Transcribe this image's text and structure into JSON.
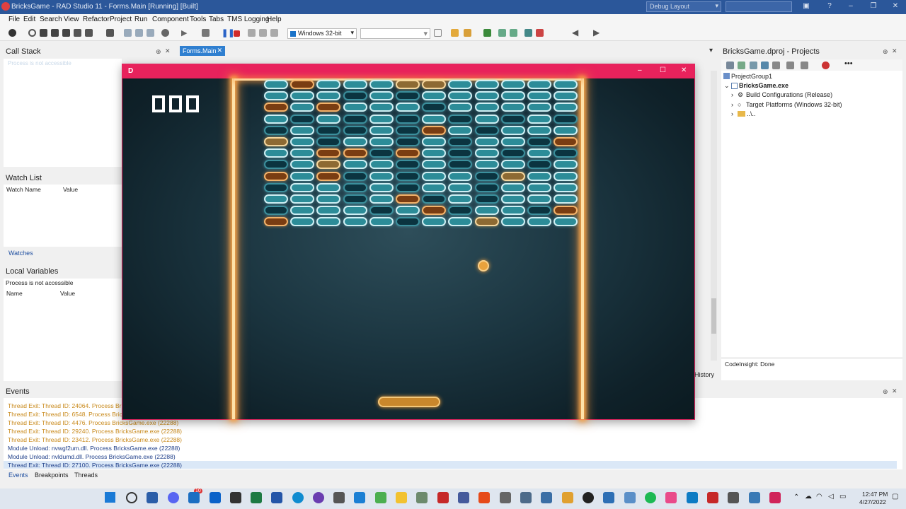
{
  "window_title": "BricksGame - RAD Studio 11 - Forms.Main [Running] [Built]",
  "layout_select": "Debug Layout",
  "menu": [
    "File",
    "Edit",
    "Search",
    "View",
    "Refactor",
    "Project",
    "Run",
    "Component",
    "Tools",
    "Tabs",
    "TMS Logging",
    "Help"
  ],
  "toolbar": {
    "platform": "Windows 32-bit"
  },
  "call_stack": {
    "title": "Call Stack",
    "message": "Process is not accessible"
  },
  "editor_tab": "Forms.Main",
  "watch_list": {
    "title": "Watch List",
    "col_name": "Watch Name",
    "col_value": "Value",
    "tab": "Watches"
  },
  "local_vars": {
    "title": "Local Variables",
    "message": "Process is not accessible",
    "col_name": "Name",
    "col_value": "Value"
  },
  "projects": {
    "title": "BricksGame.dproj - Projects",
    "group": "ProjectGroup1",
    "exe": "BricksGame.exe",
    "build_config": "Build Configurations (Release)",
    "target_platforms": "Target Platforms (Windows 32-bit)",
    "folder": "..\\..",
    "codeinsight": "CodeInsight: Done"
  },
  "history_tab": "History",
  "game": {
    "title_letter": "D",
    "score": "000"
  },
  "events": {
    "title": "Events",
    "lines": [
      {
        "text": "Thread Exit: Thread ID: 24064. Process BricksGa",
        "color": "#c98a1c"
      },
      {
        "text": "Thread Exit: Thread ID: 6548. Process BricksGam",
        "color": "#c98a1c"
      },
      {
        "text": "Thread Exit: Thread ID: 4476. Process BricksGame.exe (22288)",
        "color": "#c98a1c"
      },
      {
        "text": "Thread Exit: Thread ID: 29240. Process BricksGame.exe (22288)",
        "color": "#c98a1c"
      },
      {
        "text": "Thread Exit: Thread ID: 23412. Process BricksGame.exe (22288)",
        "color": "#c98a1c"
      },
      {
        "text": "Module Unload: nvwgf2um.dll. Process BricksGame.exe (22288)",
        "color": "#1f3f8a"
      },
      {
        "text": "Module Unload: nvldumd.dll. Process BricksGame.exe (22288)",
        "color": "#1f3f8a"
      },
      {
        "text": "Thread Exit: Thread ID: 27100. Process BricksGame.exe (22288)",
        "color": "#1f3f8a"
      }
    ],
    "tabs": [
      "Events",
      "Breakpoints",
      "Threads"
    ]
  },
  "taskbar": {
    "time": "12:47 PM",
    "date": "4/27/2022",
    "badge": "10"
  }
}
